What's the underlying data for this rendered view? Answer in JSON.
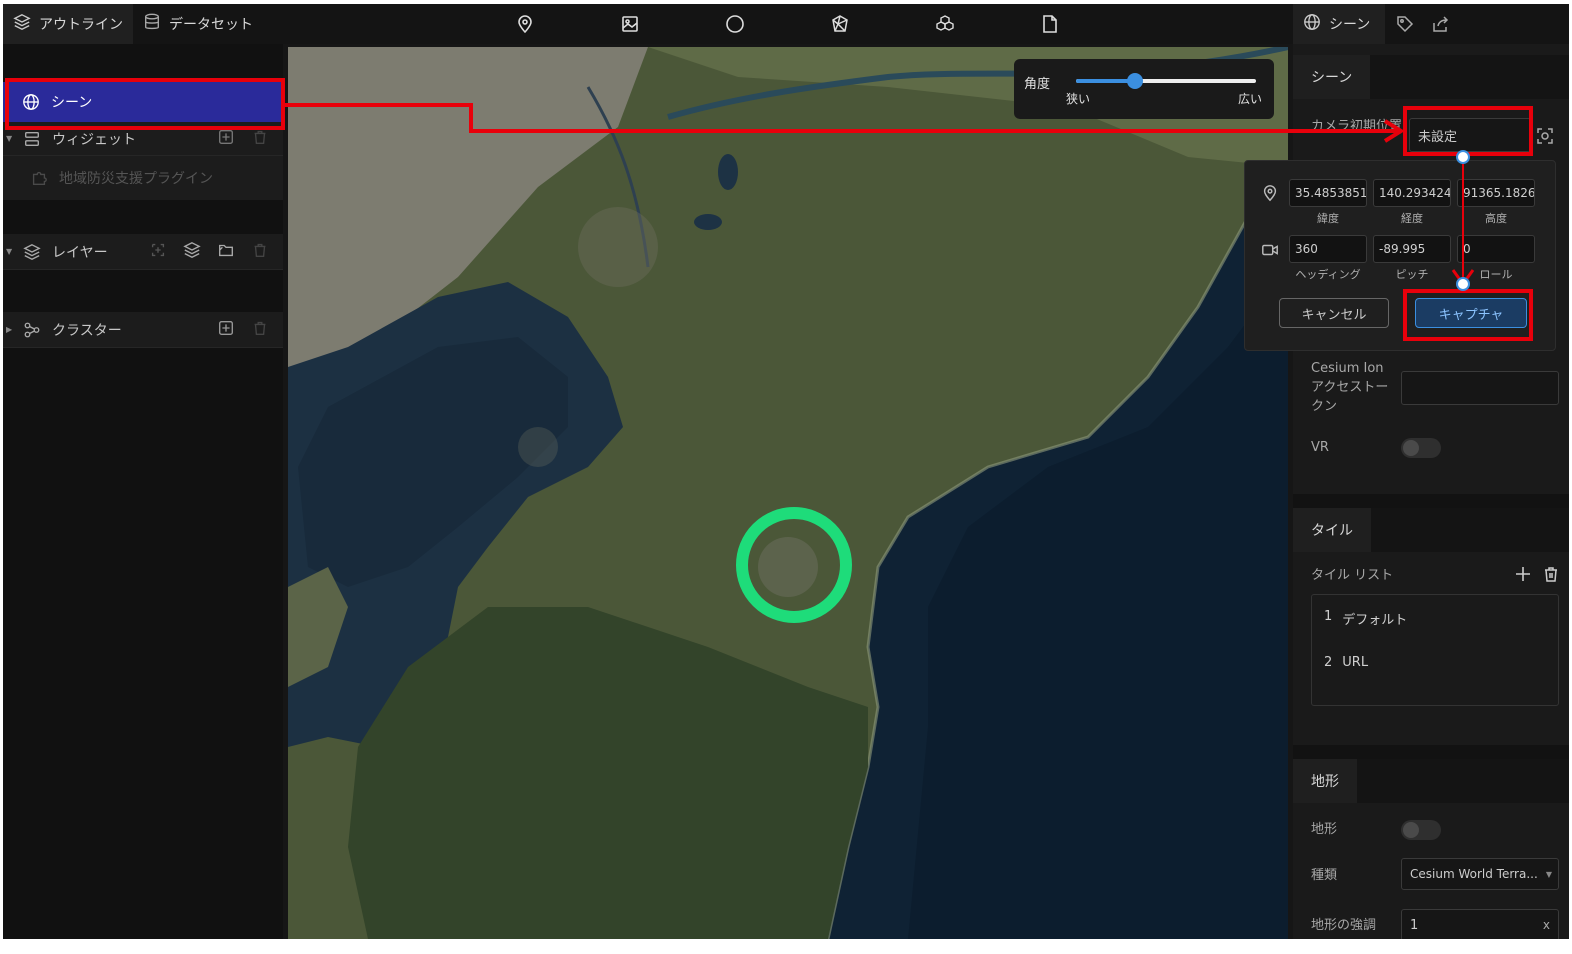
{
  "topbar": {
    "tabs": [
      {
        "label": "アウトライン",
        "icon": "layers-icon"
      },
      {
        "label": "データセット",
        "icon": "database-icon"
      }
    ],
    "tools": [
      "map-pin-icon",
      "image-icon",
      "circle-icon",
      "polyhedron-icon",
      "cubes-icon",
      "file-icon"
    ],
    "right_tabs": [
      {
        "label": "シーン",
        "icon": "globe-icon"
      },
      {
        "label": "",
        "icon": "tag-icon"
      },
      {
        "label": "",
        "icon": "export-icon"
      }
    ]
  },
  "outline": {
    "scene": {
      "label": "シーン",
      "icon": "globe-icon"
    },
    "widget": {
      "label": "ウィジェット",
      "icon": "widget-icon"
    },
    "plugin": {
      "label": "地域防災支援プラグイン",
      "icon": "puzzle-icon"
    },
    "layer": {
      "label": "レイヤー",
      "icon": "layers-icon"
    },
    "cluster": {
      "label": "クラスター",
      "icon": "cluster-icon"
    }
  },
  "map": {
    "angle_label": "角度",
    "angle_min": "狭い",
    "angle_max": "広い",
    "angle_value": 0.33,
    "marker_color": "#1edc7a"
  },
  "scene_panel": {
    "section_title": "シーン",
    "camera_label": "カメラ初期位置",
    "camera_value": "未設定",
    "cesium_label": "Cesium Ion アクセストークン",
    "cesium_value": "",
    "vr_label": "VR"
  },
  "camera_popup": {
    "latitude": "35.4853851",
    "latitude_label": "緯度",
    "longitude": "140.293424",
    "longitude_label": "経度",
    "altitude": "91365.1826",
    "altitude_label": "高度",
    "heading": "360",
    "heading_label": "ヘッディング",
    "pitch": "-89.995",
    "pitch_label": "ピッチ",
    "roll": "0",
    "roll_label": "ロール",
    "cancel": "キャンセル",
    "capture": "キャプチャ"
  },
  "tile_panel": {
    "section_title": "タイル",
    "list_label": "タイル リスト",
    "items": [
      {
        "index": "1",
        "name": "デフォルト"
      },
      {
        "index": "2",
        "name": "URL"
      }
    ]
  },
  "terrain_panel": {
    "section_title": "地形",
    "terrain_label": "地形",
    "type_label": "種類",
    "type_value": "Cesium World Terra...",
    "strength_label": "地形の強調",
    "strength_value": "1",
    "clear": "x"
  },
  "colors": {
    "annotation": "#e8000b",
    "accent": "#3b8fe0",
    "selected": "#2a2a9a"
  }
}
